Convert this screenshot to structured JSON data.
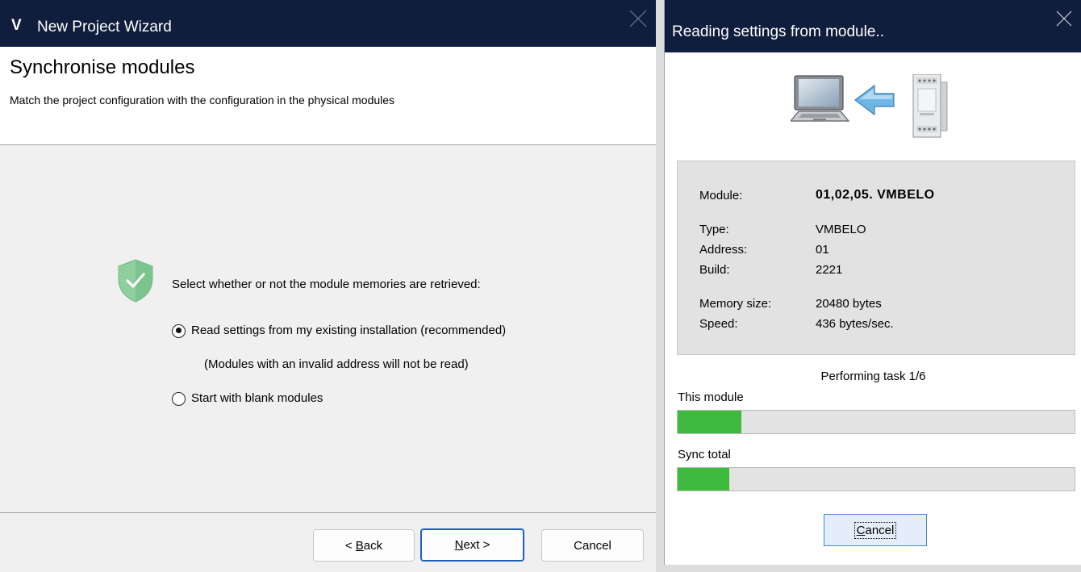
{
  "wizard": {
    "logo": "V",
    "title": "New Project Wizard",
    "heading": "Synchronise modules",
    "subheading": "Match the project configuration with the configuration in the physical modules",
    "prompt": "Select whether or not the module memories are retrieved:",
    "options": [
      {
        "label": "Read settings from my existing installation (recommended)",
        "checked": true
      },
      {
        "label": "Start with blank modules",
        "checked": false
      }
    ],
    "option_note": "(Modules with an invalid address will not be read)",
    "buttons": {
      "back": {
        "prefix": "< ",
        "mnemonic": "B",
        "rest": "ack"
      },
      "next": {
        "mnemonic": "N",
        "rest": "ext >"
      },
      "cancel": "Cancel"
    }
  },
  "dialog": {
    "title": "Reading settings from module..",
    "info": {
      "module_label": "Module:",
      "module_value": "01,02,05. VMBELO",
      "type_label": "Type:",
      "type_value": "VMBELO",
      "address_label": "Address:",
      "address_value": "01",
      "build_label": "Build:",
      "build_value": "2221",
      "memory_label": "Memory size:",
      "memory_value": "20480 bytes",
      "speed_label": "Speed:",
      "speed_value": "436 bytes/sec."
    },
    "task_status": "Performing task 1/6",
    "progress": {
      "module_label": "This module",
      "module_fraction": 0.16,
      "total_label": "Sync total",
      "total_fraction": 0.13
    },
    "cancel": {
      "mnemonic": "C",
      "rest": "ancel"
    }
  },
  "colors": {
    "titlebar": "#0f1e3d",
    "progress_fill": "#3dba3d",
    "shield": "#8fcf9e"
  },
  "icons": {
    "close": "close-icon",
    "shield": "shield-check-icon",
    "laptop": "laptop-icon",
    "arrow": "arrow-left-icon",
    "module": "din-rail-module-icon"
  }
}
